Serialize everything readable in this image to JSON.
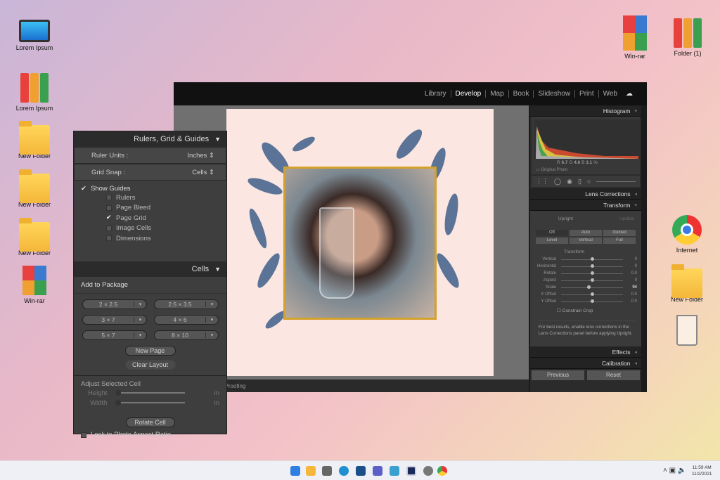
{
  "desktop": {
    "left": [
      {
        "label": "Lorem Ipsum",
        "icon": "monitor-icon"
      },
      {
        "label": "Lorem Ipsum",
        "icon": "books-icon"
      },
      {
        "label": "New Folder",
        "icon": "folder-icon"
      },
      {
        "label": "New Folder",
        "icon": "folder-icon"
      },
      {
        "label": "New Folder",
        "icon": "folder-icon"
      },
      {
        "label": "Win-rar",
        "icon": "winrar-icon"
      }
    ],
    "right": [
      {
        "label": "Win-rar",
        "icon": "winrar-icon"
      },
      {
        "label": "Folder (1)",
        "icon": "books-icon"
      },
      {
        "label": "Internet",
        "icon": "chrome-icon"
      },
      {
        "label": "New Folder",
        "icon": "folder-icon"
      },
      {
        "label": "",
        "icon": "recycle-bin-icon"
      }
    ]
  },
  "lightroom": {
    "modules": [
      "Library",
      "Develop",
      "Map",
      "Book",
      "Slideshow",
      "Print",
      "Web"
    ],
    "active_module": "Develop",
    "bottombar": {
      "rating": "★★★★",
      "soft_proofing": "Soft Proofing"
    },
    "panels": {
      "histogram": "Histogram",
      "r_label": "R",
      "r": "6.7",
      "g_label": "G",
      "g": "4.6",
      "b_label": "B",
      "b": "3.1",
      "pct": "%",
      "original_photo": "Original Photo",
      "lens_corrections": "Lens Corrections",
      "transform": "Transform",
      "upright": "Upright",
      "update": "Update",
      "upright_buttons": [
        "Off",
        "Auto",
        "Guided",
        "Level",
        "Vertical",
        "Full"
      ],
      "transform_sub": "Transform",
      "sliders": [
        {
          "label": "Vertical",
          "value": "0",
          "pos": 0.5
        },
        {
          "label": "Horizontal",
          "value": "0",
          "pos": 0.5
        },
        {
          "label": "Rotate",
          "value": "0.0",
          "pos": 0.5
        },
        {
          "label": "Aspect",
          "value": "0",
          "pos": 0.5
        },
        {
          "label": "Scale",
          "value": "94",
          "pos": 0.44
        },
        {
          "label": "X Offset",
          "value": "0.0",
          "pos": 0.5
        },
        {
          "label": "Y Offset",
          "value": "0.0",
          "pos": 0.5
        }
      ],
      "constrain_crop": "Constrain Crop",
      "note": "For best results, enable lens corrections in the Lens Corrections panel before applying Upright.",
      "effects": "Effects",
      "calibration": "Calibration",
      "previous": "Previous",
      "reset": "Reset"
    }
  },
  "float_panel": {
    "title": "Rulers, Grid & Guides",
    "ruler_units_label": "Ruler Units :",
    "ruler_units": "Inches",
    "grid_snap_label": "Grid Snap :",
    "grid_snap": "Cells",
    "show_guides": "Show Guides",
    "guides": [
      {
        "label": "Rulers",
        "checked": false
      },
      {
        "label": "Page Bleed",
        "checked": false
      },
      {
        "label": "Page Grid",
        "checked": true
      },
      {
        "label": "Image Cells",
        "checked": false
      },
      {
        "label": "Dimensions",
        "checked": false
      }
    ],
    "cells_title": "Cells",
    "add_to_package": "Add to Package",
    "sizes": [
      "2 × 2.5",
      "2.5 × 3.5",
      "3 × 7",
      "4 × 6",
      "5 × 7",
      "8 × 10"
    ],
    "new_page": "New Page",
    "clear_layout": "Clear Layout",
    "adjust_selected_cell": "Adjust Selected Cell",
    "height": "Height",
    "width": "Width",
    "unit": "in",
    "rotate_cell": "Rotate Cell",
    "lock_aspect": "Lock to Photo Aspect Ratio"
  },
  "taskbar": {
    "time": "11:59 AM",
    "date": "11/2/2021"
  }
}
